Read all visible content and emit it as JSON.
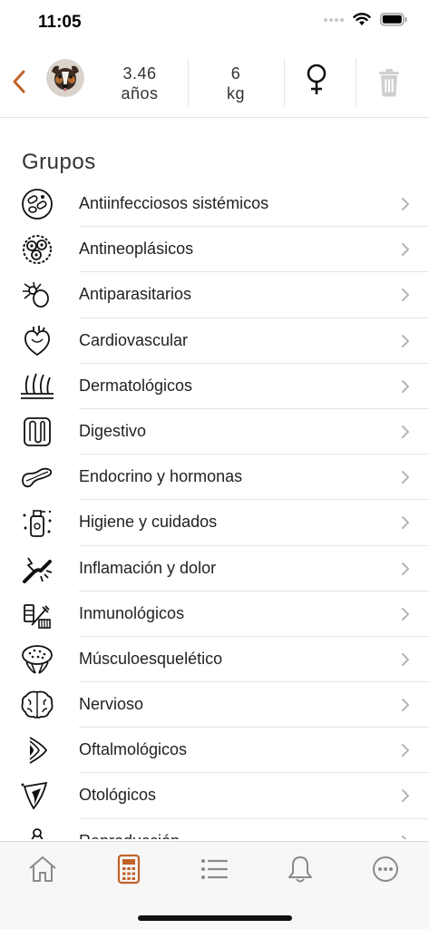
{
  "status_bar": {
    "time": "11:05"
  },
  "pet": {
    "age_value": "3.46",
    "age_unit": "años",
    "weight_value": "6",
    "weight_unit": "kg"
  },
  "colors": {
    "accent": "#c0622a",
    "icon_gray": "#8a8a8a",
    "chevron": "#b5b5b5"
  },
  "section_title": "Grupos",
  "groups": [
    {
      "label": "Antiinfecciosos sistémicos",
      "icon": "bacteria-icon"
    },
    {
      "label": "Antineoplásicos",
      "icon": "cells-icon"
    },
    {
      "label": "Antiparasitarios",
      "icon": "tick-icon"
    },
    {
      "label": "Cardiovascular",
      "icon": "heart-icon"
    },
    {
      "label": "Dermatológicos",
      "icon": "skin-icon"
    },
    {
      "label": "Digestivo",
      "icon": "intestine-icon"
    },
    {
      "label": "Endocrino y hormonas",
      "icon": "pancreas-icon"
    },
    {
      "label": "Higiene y cuidados",
      "icon": "shampoo-icon"
    },
    {
      "label": "Inflamación y dolor",
      "icon": "joint-pain-icon"
    },
    {
      "label": "Inmunológicos",
      "icon": "vaccine-icon"
    },
    {
      "label": "Músculoesquelético",
      "icon": "muscle-icon"
    },
    {
      "label": "Nervioso",
      "icon": "brain-icon"
    },
    {
      "label": "Oftalmológicos",
      "icon": "eye-icon"
    },
    {
      "label": "Otológicos",
      "icon": "ear-icon"
    },
    {
      "label": "Reproducción",
      "icon": "reproduction-icon"
    }
  ],
  "tabs": [
    {
      "name": "home",
      "icon": "home-icon",
      "active": false
    },
    {
      "name": "calculator",
      "icon": "calculator-icon",
      "active": true
    },
    {
      "name": "list",
      "icon": "list-icon",
      "active": false
    },
    {
      "name": "notifications",
      "icon": "bell-icon",
      "active": false
    },
    {
      "name": "more",
      "icon": "more-icon",
      "active": false
    }
  ]
}
